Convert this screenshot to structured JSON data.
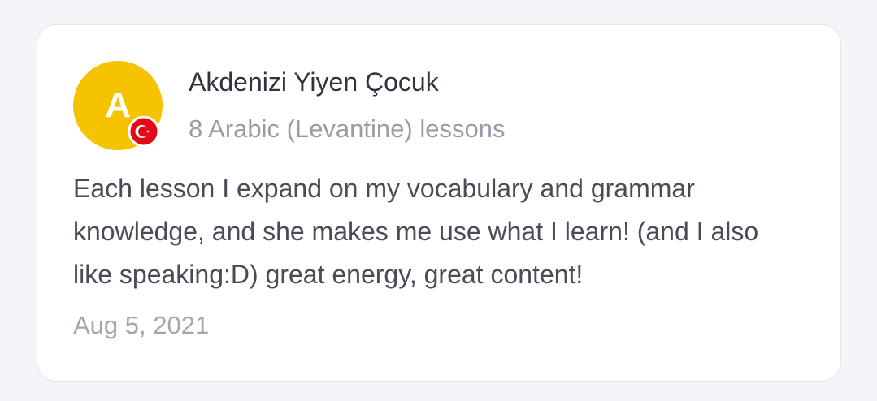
{
  "review_card": {
    "avatar": {
      "initial": "A",
      "background_color": "#f5c300",
      "flag_icon": "turkey-flag-icon",
      "flag_color": "#e30a17"
    },
    "reviewer_name": "Akdenizi Yiyen Çocuk",
    "lessons_summary": "8 Arabic (Levantine) lessons",
    "review_text": "Each lesson I expand on my vocabulary and grammar knowledge, and she makes me use what I learn! (and I also like speaking:D) great energy, great content!",
    "date": "Aug 5, 2021"
  }
}
